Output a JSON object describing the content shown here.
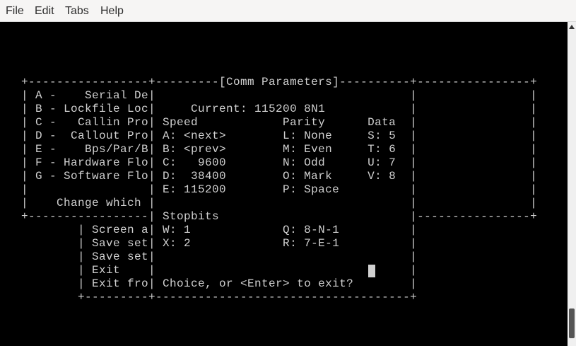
{
  "menubar": {
    "file": "File",
    "edit": "Edit",
    "tabs": "Tabs",
    "help": "Help"
  },
  "terminal": {
    "lines": [
      "",
      "",
      "",
      "",
      "   +-----------------+---------[Comm Parameters]----------+----------------+",
      "   | A -    Serial De|                                    |                |",
      "   | B - Lockfile Loc|     Current: 115200 8N1            |                |",
      "   | C -   Callin Pro| Speed            Parity      Data  |                |",
      "   | D -  Callout Pro| A: <next>        L: None     S: 5  |                |",
      "   | E -    Bps/Par/B| B: <prev>        M: Even     T: 6  |                |",
      "   | F - Hardware Flo| C:   9600        N: Odd      U: 7  |                |",
      "   | G - Software Flo| D:  38400        O: Mark     V: 8  |                |",
      "   |                 | E: 115200        P: Space          |                |",
      "   |    Change which |                                    |                |",
      "   +-----------------| Stopbits                           |----------------+",
      "           | Screen a| W: 1             Q: 8-N-1          |",
      "           | Save set| X: 2             R: 7-E-1          |",
      "           | Save set|                                    |",
      "           | Exit    |                                    |",
      "           | Exit fro| Choice, or <Enter> to exit?        |",
      "           +---------+------------------------------------+"
    ]
  }
}
